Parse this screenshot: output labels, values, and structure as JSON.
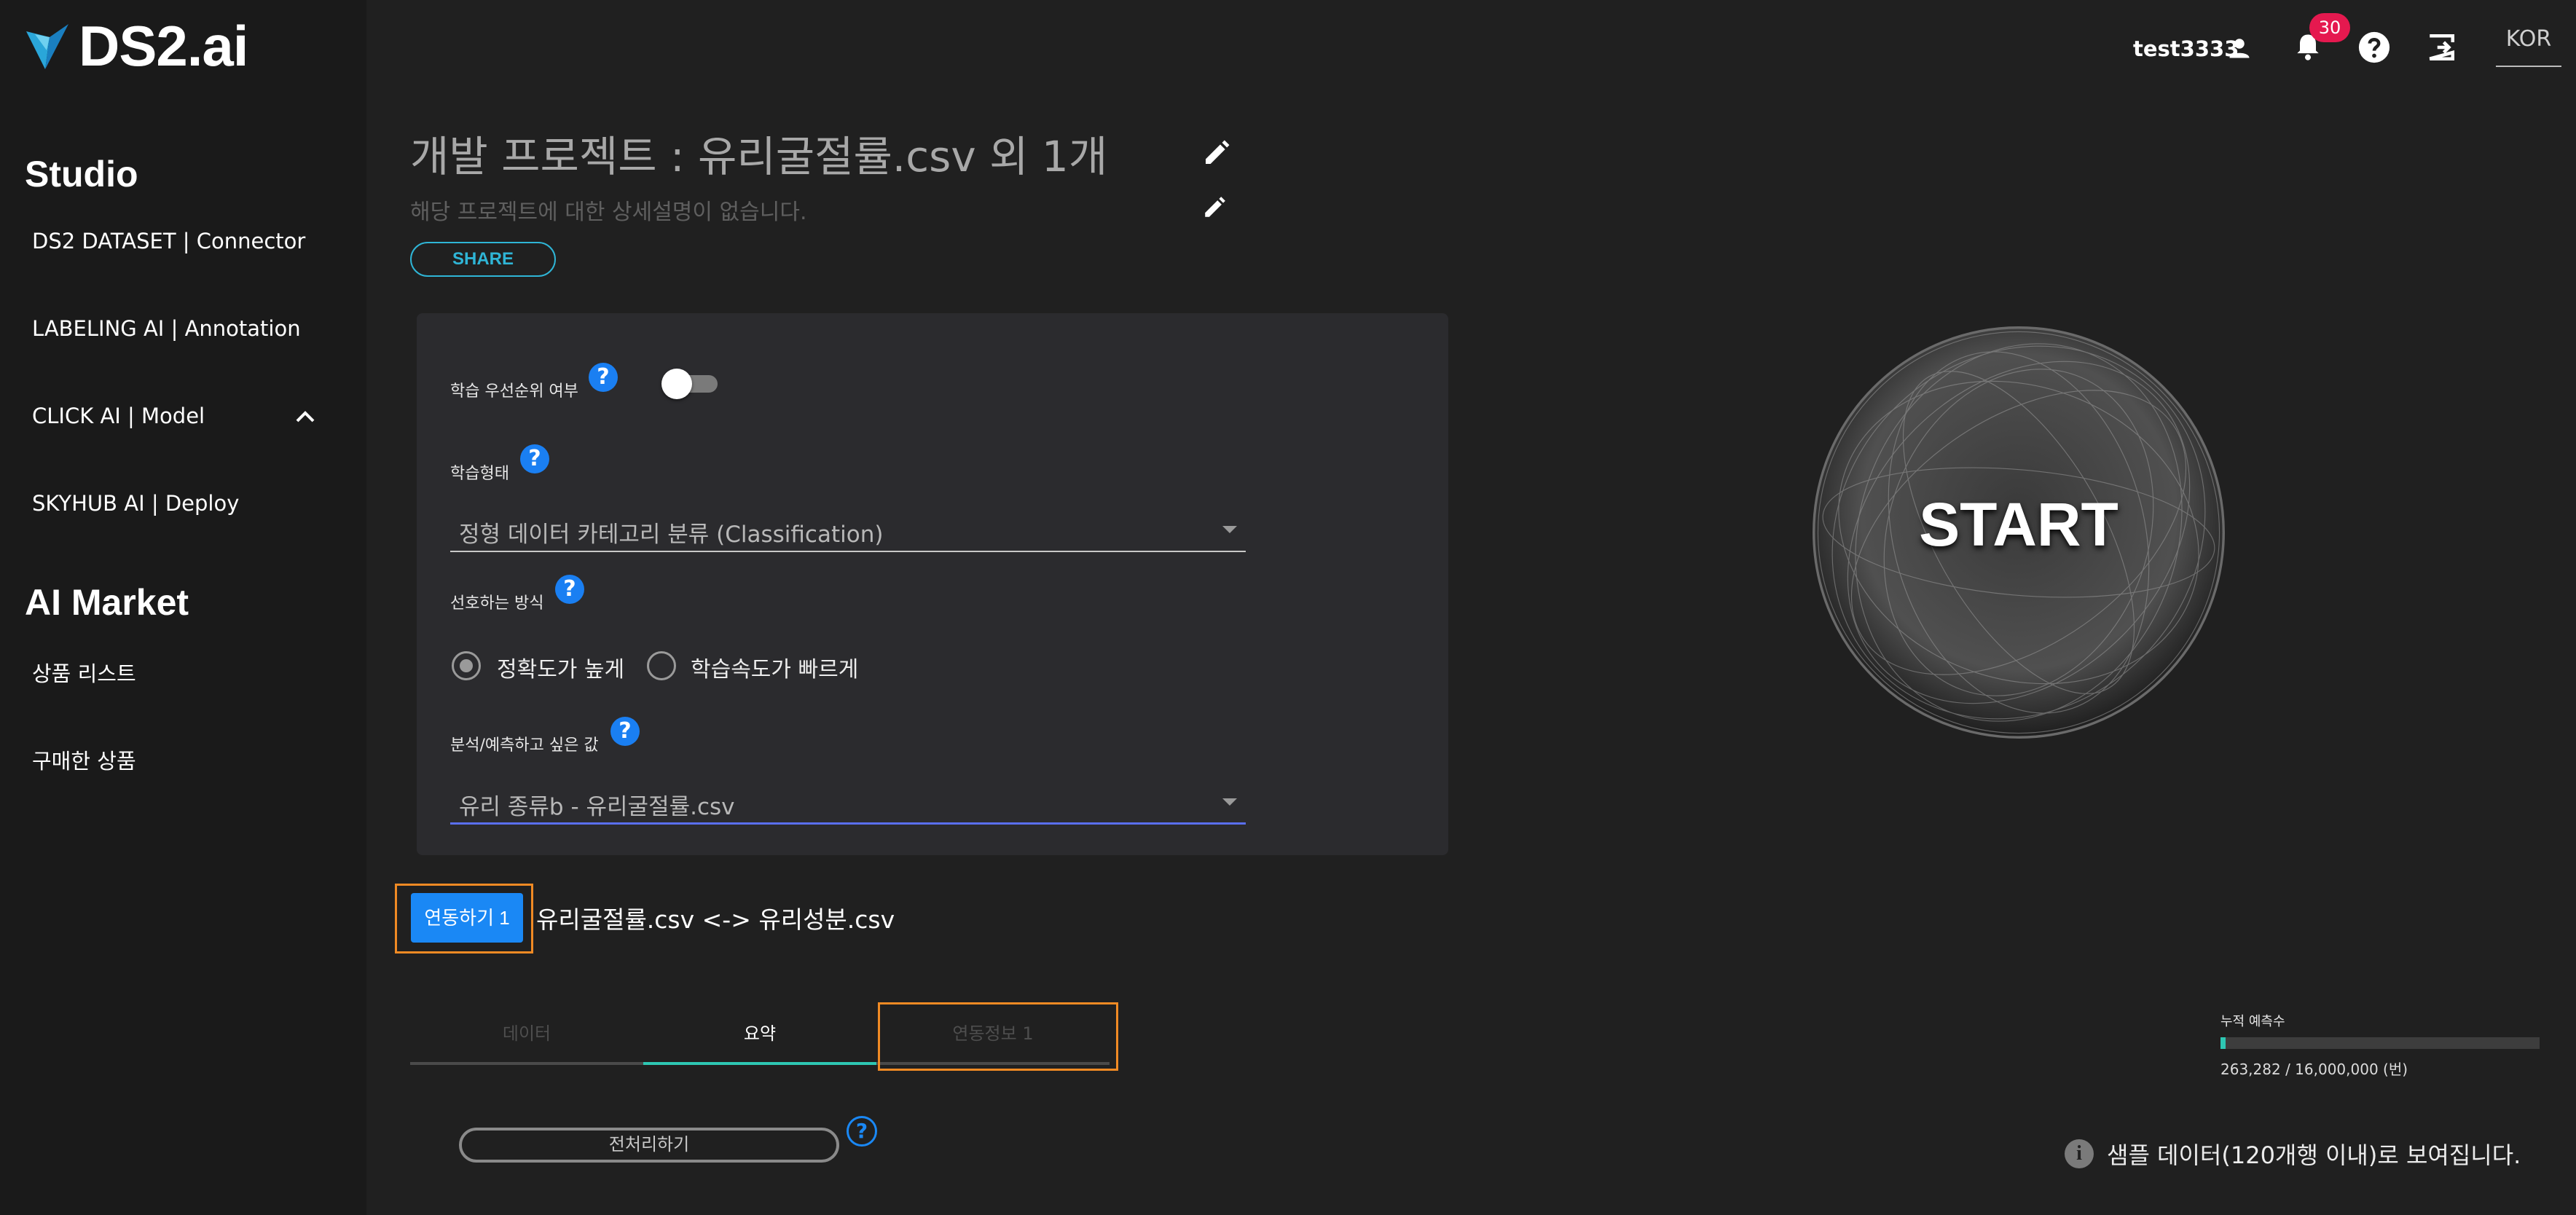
{
  "brand": {
    "name": "DS2.ai"
  },
  "sidebar": {
    "studio_title": "Studio",
    "studio_items": [
      {
        "label": "DS2 DATASET | Connector"
      },
      {
        "label": "LABELING AI | Annotation"
      },
      {
        "label": "CLICK AI | Model"
      },
      {
        "label": "SKYHUB AI | Deploy"
      }
    ],
    "market_title": "AI Market",
    "market_items": [
      {
        "label": "상품 리스트"
      },
      {
        "label": "구매한 상품"
      }
    ]
  },
  "topbar": {
    "username": "test3333",
    "notification_count": "30",
    "language": "KOR"
  },
  "project": {
    "title": "개발 프로젝트 : 유리굴절률.csv 외 1개",
    "description": "해당 프로젝트에 대한 상세설명이 없습니다.",
    "share_label": "SHARE"
  },
  "settings": {
    "priority_label": "학습 우선순위 여부",
    "priority_enabled": false,
    "training_type_label": "학습형태",
    "training_type_value": "정형 데이터 카테고리 분류 (Classification)",
    "method_label": "선호하는 방식",
    "method_options": [
      {
        "label": "정확도가 높게",
        "selected": true
      },
      {
        "label": "학습속도가 빠르게",
        "selected": false
      }
    ],
    "target_label": "분석/예측하고 싶은 값",
    "target_value": "유리 종류b - 유리굴절률.csv"
  },
  "connect": {
    "button_label": "연동하기 1",
    "relation": "유리굴절률.csv <-> 유리성분.csv"
  },
  "tabs": [
    {
      "label": "데이터",
      "active": false
    },
    {
      "label": "요약",
      "active": true
    },
    {
      "label": "연동정보 1",
      "active": false
    }
  ],
  "preprocess_label": "전처리하기",
  "start_label": "START",
  "predictions": {
    "label": "누적 예측수",
    "count_text": "263,282 / 16,000,000 (번)",
    "fraction": 0.0165
  },
  "sample_notice": "샘플 데이터(120개행 이내)로 보여집니다.",
  "colors": {
    "accent_blue": "#1a88f5",
    "teal": "#2ec7b3",
    "highlight_orange": "#f08a24",
    "badge_red": "#e5194f"
  }
}
